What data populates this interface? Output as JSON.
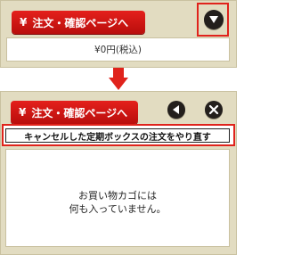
{
  "top_panel": {
    "order_button_label": "注文・確認ページへ",
    "order_button_icon": "¥",
    "toggle_icon": "triangle-down-icon",
    "total_text": "¥0円(税込)"
  },
  "bottom_panel": {
    "order_button_label": "注文・確認ページへ",
    "order_button_icon": "¥",
    "back_icon": "triangle-left-icon",
    "close_icon": "close-icon",
    "cancel_link_text": "キャンセルした定期ボックスの注文をやり直す",
    "cart_empty_line1": "お買い物カゴには",
    "cart_empty_line2": "何も入っていません。"
  },
  "colors": {
    "panel_bg": "#e2dcc1",
    "accent_red": "#e0231c",
    "button_red": "#c8120f",
    "icon_dark": "#231f1c"
  }
}
